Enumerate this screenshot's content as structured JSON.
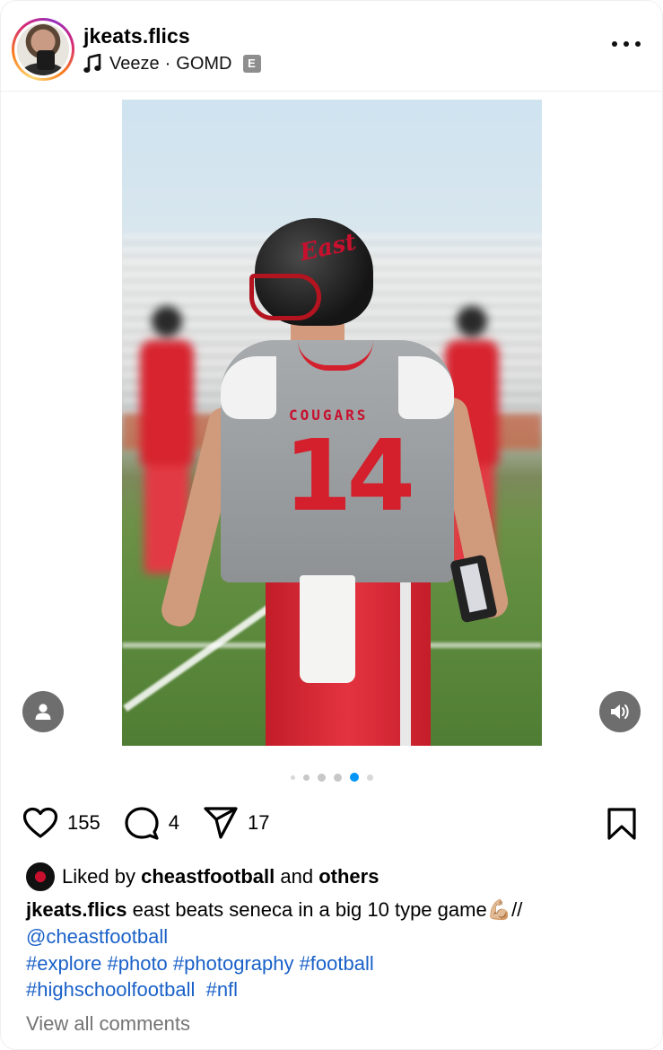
{
  "header": {
    "username": "jkeats.flics",
    "song_artist": "Veeze",
    "song_separator": "·",
    "song_title": "GOMD",
    "explicit_badge": "E"
  },
  "media": {
    "helmet_text": "East",
    "jersey_team": "COUGARS",
    "jersey_number": "14",
    "carousel_count": 6,
    "carousel_active_index": 4
  },
  "actions": {
    "likes": "155",
    "comments": "4",
    "shares": "17"
  },
  "liked_by": {
    "prefix": "Liked by",
    "user": "cheastfootball",
    "conjunction": "and",
    "suffix": "others"
  },
  "caption": {
    "user": "jkeats.flics",
    "text": "east beats seneca in a big 10 type game💪🏼//",
    "mention": "@cheastfootball",
    "hashtags_line1": "#explore #photo #photography #football",
    "hashtags_line2": "#highschoolfootball  #nfl"
  },
  "comments_link": "View all comments",
  "colors": {
    "link": "#1a61c8",
    "muted": "#737373",
    "carousel_active": "#0095f6",
    "carousel_inactive": "#c7c7c7"
  }
}
